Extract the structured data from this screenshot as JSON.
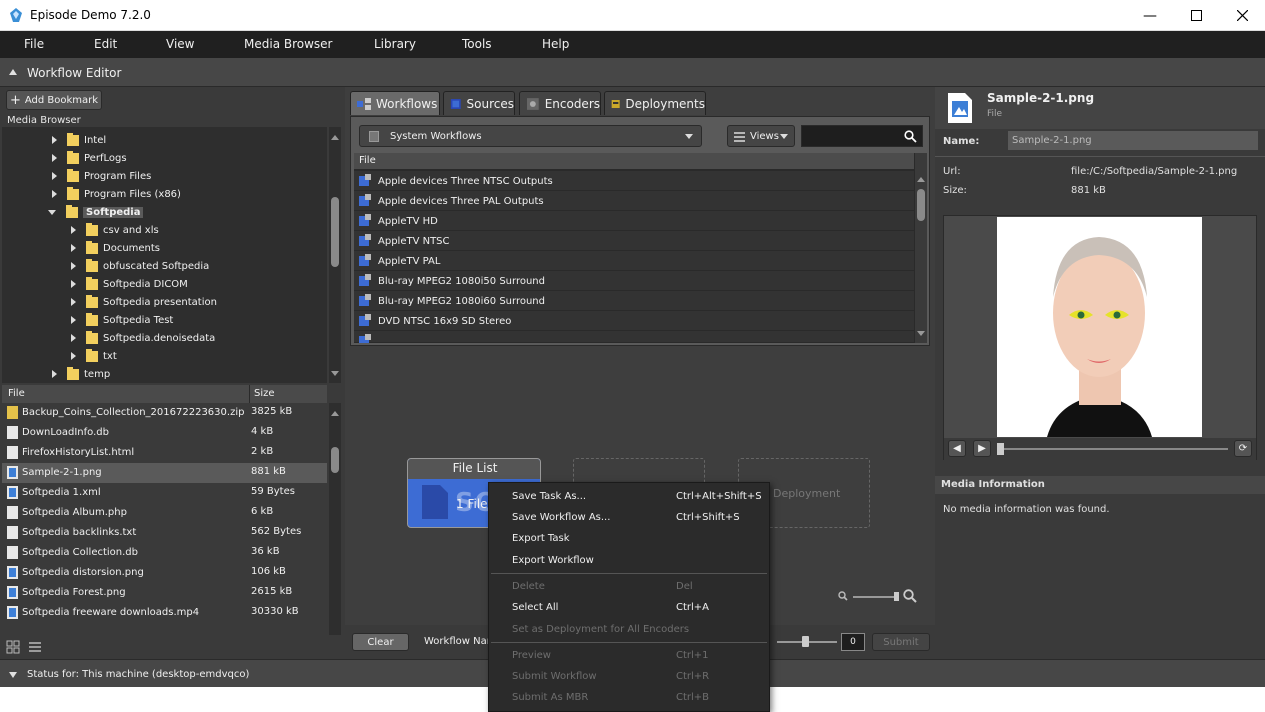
{
  "window": {
    "title": "Episode Demo 7.2.0"
  },
  "menu": [
    "File",
    "Edit",
    "View",
    "Media Browser",
    "Library",
    "Tools",
    "Help"
  ],
  "workflow_editor": {
    "label": "Workflow Editor"
  },
  "left": {
    "add_bookmark": "Add Bookmark",
    "media_browser_label": "Media Browser",
    "tree": [
      {
        "name": "Intel",
        "level": 0
      },
      {
        "name": "PerfLogs",
        "level": 0
      },
      {
        "name": "Program Files",
        "level": 0
      },
      {
        "name": "Program Files (x86)",
        "level": 0
      },
      {
        "name": "Softpedia",
        "level": 0,
        "expanded": true,
        "selected": true
      },
      {
        "name": "csv and xls",
        "level": 1
      },
      {
        "name": "Documents",
        "level": 1
      },
      {
        "name": "obfuscated Softpedia",
        "level": 1
      },
      {
        "name": "Softpedia DICOM",
        "level": 1
      },
      {
        "name": "Softpedia presentation",
        "level": 1
      },
      {
        "name": "Softpedia Test",
        "level": 1
      },
      {
        "name": "Softpedia.denoisedata",
        "level": 1
      },
      {
        "name": "txt",
        "level": 1
      },
      {
        "name": "temp",
        "level": 0
      }
    ],
    "file_headers": {
      "file": "File",
      "size": "Size"
    },
    "files": [
      {
        "name": "Backup_Coins_Collection_201672223630.zip",
        "size": "3825 kB",
        "icon": "zip"
      },
      {
        "name": "DownLoadInfo.db",
        "size": "4 kB",
        "icon": "doc"
      },
      {
        "name": "FirefoxHistoryList.html",
        "size": "2 kB",
        "icon": "doc"
      },
      {
        "name": "Sample-2-1.png",
        "size": "881 kB",
        "icon": "img",
        "selected": true
      },
      {
        "name": "Softpedia 1.xml",
        "size": "59 Bytes",
        "icon": "img"
      },
      {
        "name": "Softpedia Album.php",
        "size": "6 kB",
        "icon": "doc"
      },
      {
        "name": "Softpedia backlinks.txt",
        "size": "562 Bytes",
        "icon": "doc"
      },
      {
        "name": "Softpedia Collection.db",
        "size": "36 kB",
        "icon": "doc"
      },
      {
        "name": "Softpedia distorsion.png",
        "size": "106 kB",
        "icon": "img"
      },
      {
        "name": "Softpedia Forest.png",
        "size": "2615 kB",
        "icon": "img"
      },
      {
        "name": "Softpedia freeware downloads.mp4",
        "size": "30330 kB",
        "icon": "img"
      }
    ]
  },
  "center": {
    "tabs": [
      {
        "label": "Workflows",
        "active": true
      },
      {
        "label": "Sources"
      },
      {
        "label": "Encoders"
      },
      {
        "label": "Deployments"
      }
    ],
    "system_workflows": "System Workflows",
    "views": "Views",
    "table_header": "File",
    "workflows": [
      "Apple devices Three NTSC Outputs",
      "Apple devices Three PAL Outputs",
      "AppleTV HD",
      "AppleTV NTSC",
      "AppleTV PAL",
      "Blu-ray MPEG2 1080i50 Surround",
      "Blu-ray MPEG2 1080i60 Surround",
      "DVD NTSC 16x9 SD Stereo"
    ],
    "file_list_title": "File List",
    "file_list_count": "1 File",
    "deployment_placeholder": "Deployment",
    "watermark": "SOFTPEDIA",
    "clear": "Clear",
    "workflow_name_label": "Workflow Nam",
    "counter_value": "0",
    "submit": "Submit"
  },
  "right": {
    "file_title": "Sample-2-1.png",
    "file_subtitle": "File",
    "name_label": "Name:",
    "name_value": "Sample-2-1.png",
    "url_label": "Url:",
    "url_value": "file:/C:/Softpedia/Sample-2-1.png",
    "size_label": "Size:",
    "size_value": "881 kB",
    "media_info_label": "Media Information",
    "media_info_value": "No media information was found."
  },
  "status": {
    "label": "Status for:  This machine (desktop-emdvqco)"
  },
  "context_menu": [
    {
      "label": "Save Task As...",
      "shortcut": "Ctrl+Alt+Shift+S"
    },
    {
      "label": "Save Workflow As...",
      "shortcut": "Ctrl+Shift+S"
    },
    {
      "label": "Export Task",
      "shortcut": ""
    },
    {
      "label": "Export Workflow",
      "shortcut": ""
    },
    {
      "separator": true
    },
    {
      "label": "Delete",
      "shortcut": "Del",
      "disabled": true
    },
    {
      "label": "Select All",
      "shortcut": "Ctrl+A"
    },
    {
      "label": "Set as Deployment for All Encoders",
      "shortcut": "",
      "disabled": true
    },
    {
      "separator": true
    },
    {
      "label": "Preview",
      "shortcut": "Ctrl+1",
      "disabled": true
    },
    {
      "label": "Submit Workflow",
      "shortcut": "Ctrl+R",
      "disabled": true
    },
    {
      "label": "Submit As MBR",
      "shortcut": "Ctrl+B",
      "disabled": true
    }
  ],
  "colors": {
    "accent": "#3d6cd4",
    "folder": "#f2cf5e",
    "panel_dark": "#2e2e2e",
    "menu_bg": "#202020"
  }
}
